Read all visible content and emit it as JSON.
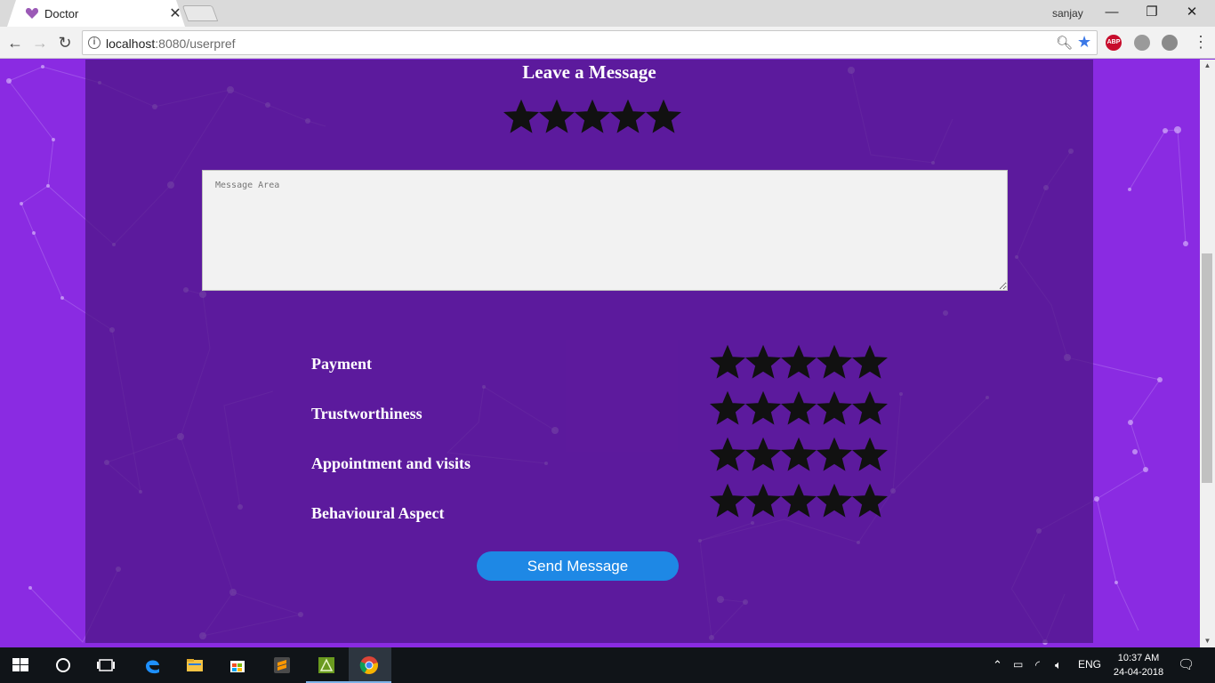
{
  "browser": {
    "tab_title": "Doctor",
    "profile_name": "sanjay",
    "url_host": "localhost",
    "url_path": ":8080/userpref",
    "extensions": [
      {
        "name": "adblock-plus-icon",
        "text": "ABP",
        "color": "#c70d2c"
      },
      {
        "name": "extension-gray-icon",
        "text": "",
        "color": "#9a9a9a"
      },
      {
        "name": "shield-extension-icon",
        "text": "",
        "color": "#8a8a8a"
      }
    ]
  },
  "page": {
    "heading": "Leave a Message",
    "overall_rating": {
      "value": 5,
      "max": 5
    },
    "message_placeholder": "Message Area",
    "message_value": "",
    "ratings": [
      {
        "label": "Payment",
        "value": 5,
        "max": 5
      },
      {
        "label": "Trustworthiness",
        "value": 5,
        "max": 5
      },
      {
        "label": "Appointment and visits",
        "value": 5,
        "max": 5
      },
      {
        "label": "Behavioural Aspect",
        "value": 5,
        "max": 5
      }
    ],
    "send_button": "Send Message",
    "colors": {
      "background": "#8a2be2",
      "panel": "#4b1482",
      "star": "#111111",
      "button": "#1e88e5"
    }
  },
  "taskbar": {
    "apps": [
      {
        "name": "start-button",
        "icon": "windows-icon"
      },
      {
        "name": "cortana-button",
        "icon": "search-circle-icon"
      },
      {
        "name": "task-view-button",
        "icon": "task-view-icon"
      },
      {
        "name": "edge-button",
        "icon": "edge-icon"
      },
      {
        "name": "file-explorer-button",
        "icon": "folder-icon"
      },
      {
        "name": "store-button",
        "icon": "store-icon"
      },
      {
        "name": "sublime-text-button",
        "icon": "sublime-icon"
      },
      {
        "name": "app-button",
        "icon": "app-green-icon"
      },
      {
        "name": "chrome-button",
        "icon": "chrome-icon"
      }
    ],
    "language": "ENG",
    "time": "10:37 AM",
    "date": "24-04-2018"
  }
}
